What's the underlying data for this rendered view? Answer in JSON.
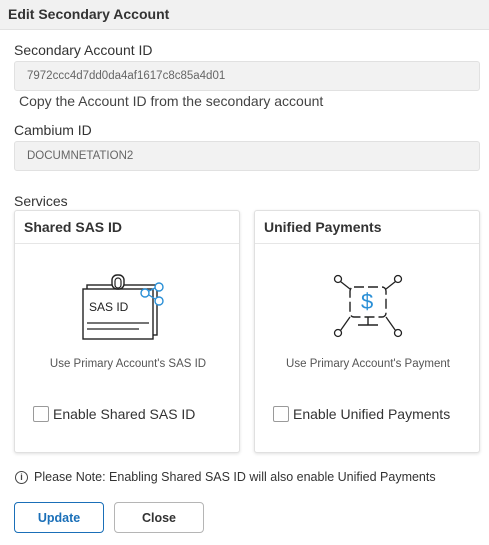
{
  "dialog": {
    "title": "Edit Secondary Account"
  },
  "secondary_account": {
    "label": "Secondary Account ID",
    "value": "7972ccc4d7dd0da4af1617c8c85a4d01",
    "help": "Copy the Account ID from the secondary account"
  },
  "cambium": {
    "label": "Cambium ID",
    "value": "DOCUMNETATION2"
  },
  "services": {
    "label": "Services",
    "cards": [
      {
        "title": "Shared SAS ID",
        "illustration_text": "SAS ID",
        "icon": "sas-id-card-icon",
        "description": "Use Primary Account's SAS ID",
        "checkbox_label": "Enable Shared SAS ID",
        "checked": false
      },
      {
        "title": "Unified Payments",
        "icon": "payment-monitor-icon",
        "description": "Use Primary Account's Payment",
        "checkbox_label": "Enable Unified Payments",
        "checked": false
      }
    ]
  },
  "note": {
    "icon": "info-icon",
    "text": "Please Note: Enabling Shared SAS ID will also enable Unified Payments"
  },
  "buttons": {
    "update": "Update",
    "close": "Close"
  },
  "colors": {
    "accent": "#1a6fb8",
    "header_bg": "#f1f1f1",
    "input_bg": "#f2f2f2"
  }
}
